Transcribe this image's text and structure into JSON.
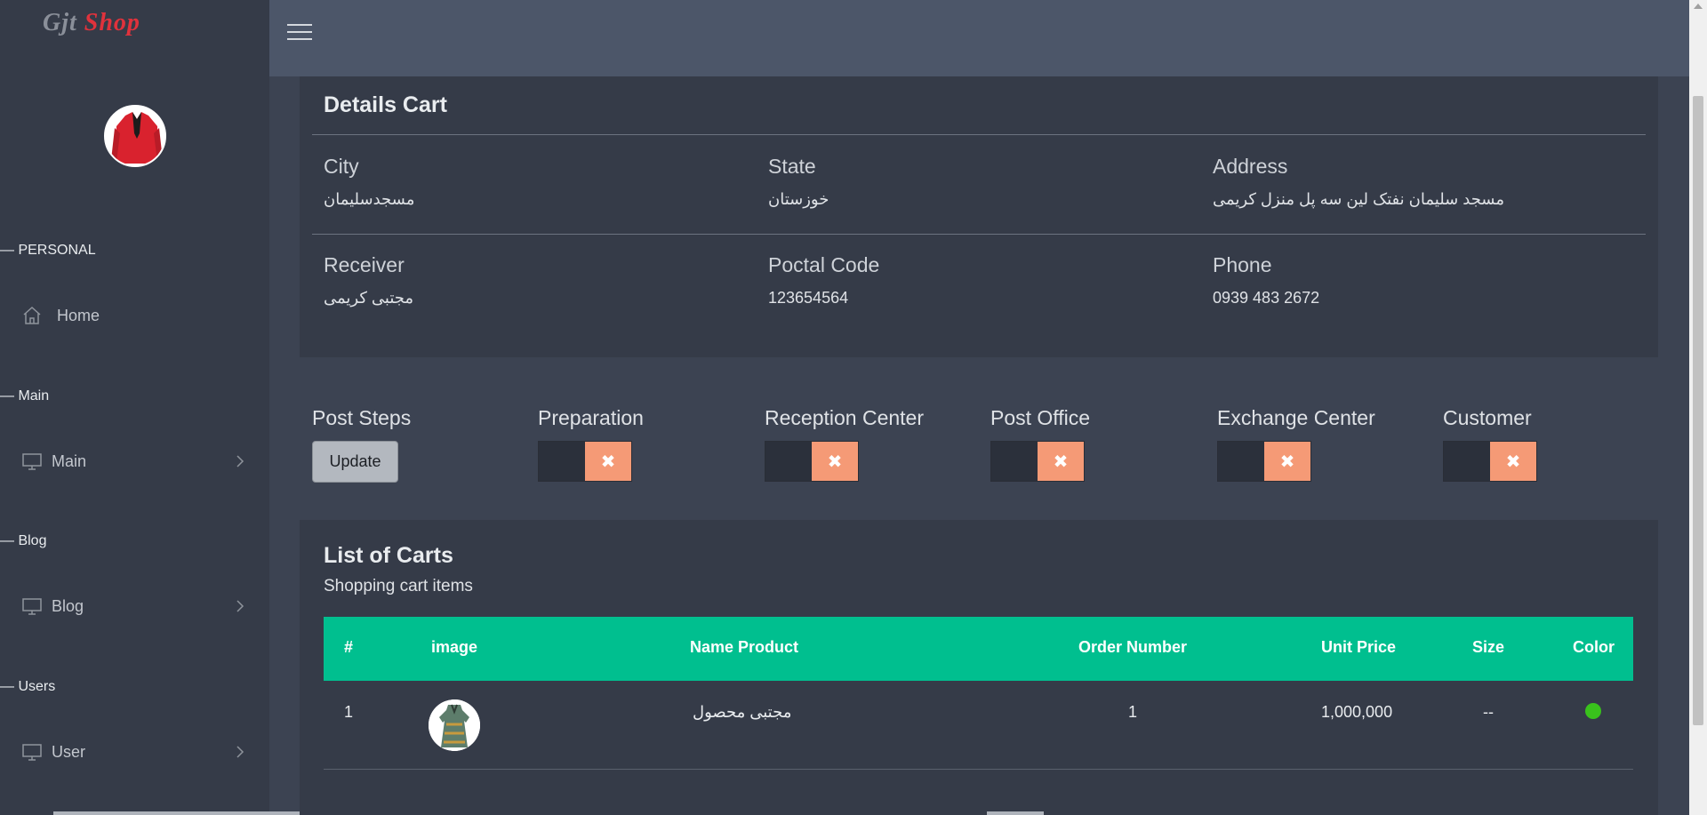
{
  "brand": {
    "word1": "Gjt",
    "word2": "Shop"
  },
  "sidebar": {
    "sections": [
      {
        "label": "— PERSONAL",
        "items": [
          {
            "label": "Home",
            "icon": "home-icon"
          }
        ]
      },
      {
        "label": "— Main",
        "items": [
          {
            "label": "Main",
            "icon": "monitor-icon"
          }
        ]
      },
      {
        "label": "— Blog",
        "items": [
          {
            "label": "Blog",
            "icon": "monitor-icon"
          }
        ]
      },
      {
        "label": "— Users",
        "items": [
          {
            "label": "User",
            "icon": "monitor-icon"
          }
        ]
      }
    ]
  },
  "details": {
    "title": "Details Cart",
    "fields": {
      "city": {
        "label": "City",
        "value": "مسجدسلیمان"
      },
      "state": {
        "label": "State",
        "value": "خوزستان"
      },
      "address": {
        "label": "Address",
        "value": "مسجد سلیمان نفتک لین سه پل منزل کریمی"
      },
      "receiver": {
        "label": "Receiver",
        "value": "مجتبی کریمی"
      },
      "postal": {
        "label": "Poctal Code",
        "value": "123654564"
      },
      "phone": {
        "label": "Phone",
        "value": "0939 483 2672"
      }
    }
  },
  "post_steps": {
    "label": "Post Steps",
    "update_label": "Update",
    "steps": [
      {
        "label": "Preparation",
        "toggle_symbol": "✖"
      },
      {
        "label": "Reception Center",
        "toggle_symbol": "✖"
      },
      {
        "label": "Post Office",
        "toggle_symbol": "✖"
      },
      {
        "label": "Exchange Center",
        "toggle_symbol": "✖"
      },
      {
        "label": "Customer",
        "toggle_symbol": "✖"
      }
    ]
  },
  "cart_list": {
    "title": "List of Carts",
    "subtitle": "Shopping cart items",
    "columns": [
      "#",
      "image",
      "Name Product",
      "Order Number",
      "Unit Price",
      "Size",
      "Color"
    ],
    "rows": [
      {
        "index": "1",
        "name": "مجتبی محصول",
        "order_number": "1",
        "unit_price": "1,000,000",
        "size": "--",
        "color": "#39c21c"
      }
    ]
  },
  "colors": {
    "sidebar_bg": "#353b48",
    "topbar_bg": "#4c5669",
    "accent_green": "#00bf8f",
    "toggle_x": "#f59a76"
  }
}
